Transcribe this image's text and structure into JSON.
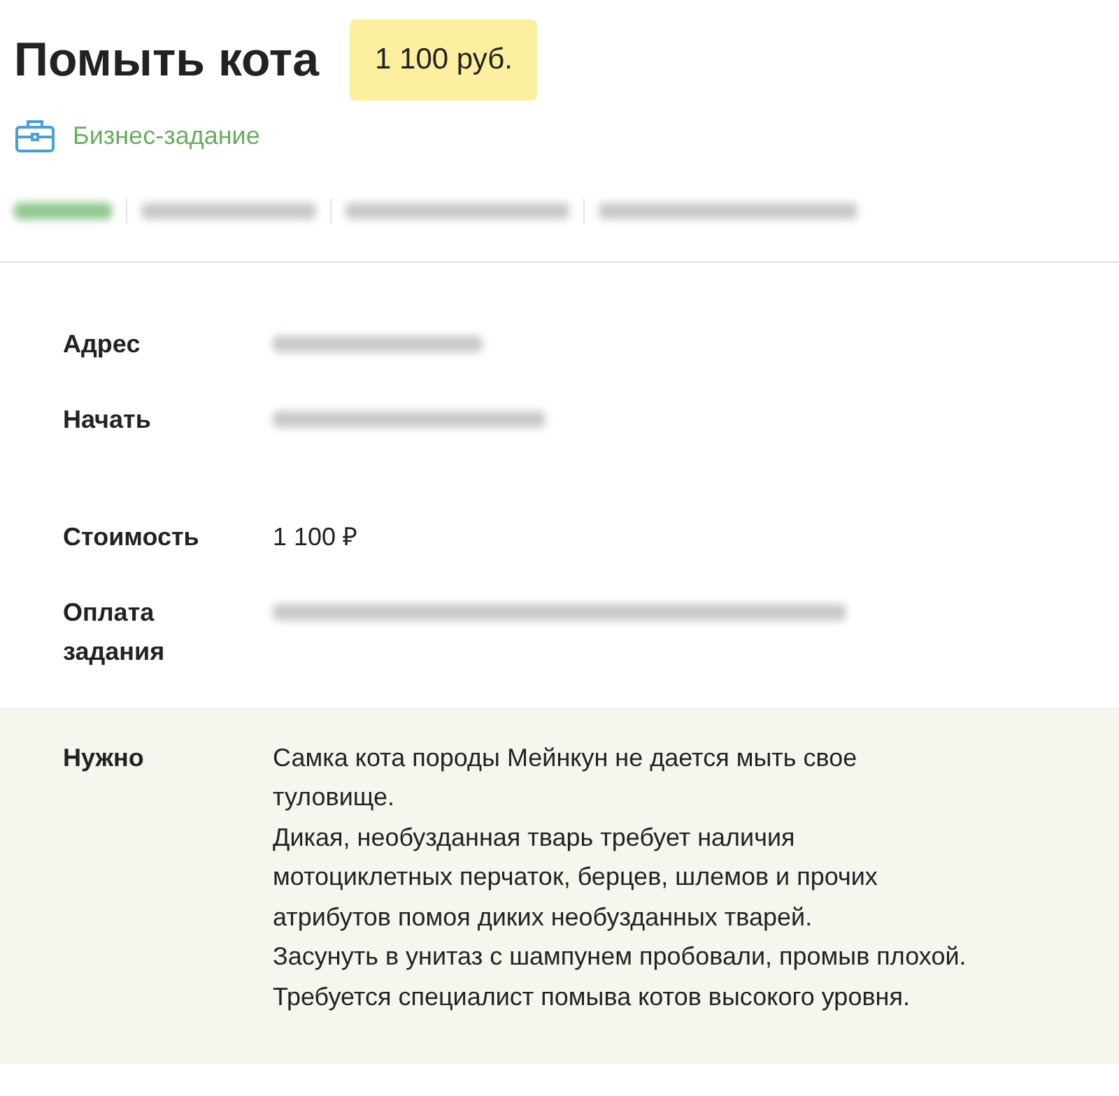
{
  "title": "Помыть кота",
  "price_badge": "1 100 руб.",
  "category": "Бизнес-задание",
  "status_tabs": [
    {
      "kind": "blurred",
      "selected": true
    },
    {
      "kind": "blurred",
      "selected": false
    },
    {
      "kind": "blurred",
      "selected": false
    },
    {
      "kind": "blurred",
      "selected": false
    }
  ],
  "details": [
    {
      "label": "Адрес",
      "kind": "blurred"
    },
    {
      "label": "Начать",
      "kind": "blurred"
    },
    {
      "label": "Стоимость",
      "kind": "text",
      "value": "1 100 ₽"
    },
    {
      "label": "Оплата задания",
      "kind": "blurred"
    }
  ],
  "requirement": {
    "label": "Нужно",
    "paragraphs": [
      "Самка кота породы Мейнкун не дается мыть свое туловище.",
      "Дикая, необузданная тварь требует наличия мотоциклетных перчаток, берцев, шлемов и прочих атрибутов помоя диких необузданных тварей.",
      "Засунуть в унитаз с шампунем пробовали, промыв плохой.",
      "Требуется специалист помыва котов высокого уровня."
    ]
  }
}
